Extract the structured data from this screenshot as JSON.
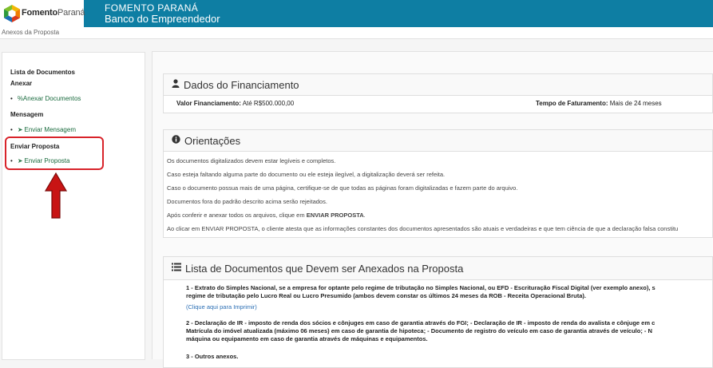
{
  "header": {
    "logo_bold": "Fomento",
    "logo_light": "Paraná",
    "title_line1": "FOMENTO PARANÁ",
    "title_line2": "Banco do Empreendedor"
  },
  "breadcrumb": "Anexos da Proposta",
  "sidebar": {
    "section1_title": "Lista de Documentos",
    "section2_title": "Anexar",
    "anexar_item": "%Anexar Documentos",
    "section3_title": "Mensagem",
    "mensagem_item": "Enviar Mensagem",
    "section4_title": "Enviar Proposta",
    "enviar_item": "Enviar Proposta"
  },
  "financiamento": {
    "title": "Dados do Financiamento",
    "valor_label": "Valor Financiamento:",
    "valor_value": "Até R$500.000,00",
    "tempo_label": "Tempo de Faturamento:",
    "tempo_value": "Mais de 24 meses"
  },
  "orientacoes": {
    "title": "Orientações",
    "lines": [
      "Os documentos digitalizados devem estar legíveis e completos.",
      "Caso esteja faltando alguma parte do documento ou ele esteja ilegível, a digitalização deverá ser refeita.",
      "Caso o documento possua mais de uma página, certifique-se de que todas as páginas foram digitalizadas e fazem parte do arquivo.",
      "Documentos fora do padrão descrito acima serão rejeitados."
    ],
    "line5_prefix": "Após conferir e anexar todos os arquivos, clique em ",
    "line5_bold": "ENVIAR PROPOSTA",
    "line5_suffix": ".",
    "line6": "Ao clicar em ENVIAR PROPOSTA, o cliente atesta que as informações constantes dos documentos apresentados são atuais e verdadeiras e que tem ciência de que a declaração falsa constitu"
  },
  "lista": {
    "title": "Lista de Documentos que Devem ser Anexados na Proposta",
    "item1_line1": "1 - Extrato do Simples Nacional, se a empresa for optante pelo regime de tributação no Simples Nacional, ou EFD - Escrituração Fiscal Digital (ver exemplo anexo), s",
    "item1_line2": "regime de tributação pelo Lucro Real ou Lucro Presumido (ambos devem constar os últimos 24 meses da ROB - Receita Operacional Bruta).",
    "item1_link": "(Clique aqui para Imprimir)",
    "item2_line1": "2 - Declaração de IR - imposto de renda dos sócios e cônjuges em caso de garantia através do FGI; - Declaração de IR - imposto de renda do avalista e cônjuge em c",
    "item2_line2": "Matrícula do imóvel atualizada (máximo 06 meses) em caso de garantia de hipoteca; - Documento de registro do veículo em caso de garantia através de veículo; - N",
    "item2_line3": "máquina ou equipamento em caso de garantia através de máquinas e equipamentos.",
    "item3": "3 - Outros anexos."
  },
  "colors": {
    "header_bg": "#0e7ea3",
    "link_green": "#1a6b3e",
    "highlight_red": "#d8232a"
  }
}
